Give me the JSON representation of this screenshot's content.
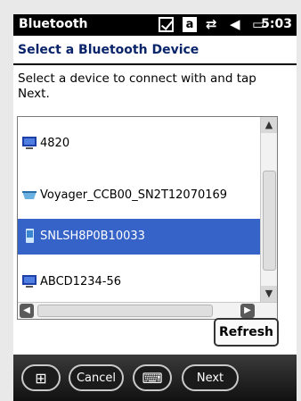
{
  "statusbar": {
    "title": "Bluetooth",
    "a_badge": "a",
    "time": "5:03",
    "icons": [
      "checkbox-icon",
      "a-badge-icon",
      "sync-icon",
      "volume-icon",
      "battery-icon"
    ]
  },
  "page": {
    "header": "Select a Bluetooth Device",
    "instruction": "Select a device to connect with and tap Next."
  },
  "devices": [
    {
      "label": "4820",
      "icon": "computer-icon",
      "selected": false
    },
    {
      "label": "Voyager_CCB00_SN2T12070169",
      "icon": "scanner-icon",
      "selected": false
    },
    {
      "label": "SNLSH8P0B10033",
      "icon": "phone-icon",
      "selected": true
    },
    {
      "label": "ABCD1234-56",
      "icon": "computer-icon",
      "selected": false
    }
  ],
  "buttons": {
    "refresh": "Refresh",
    "cancel": "Cancel",
    "next": "Next"
  },
  "colors": {
    "selection": "#3563c8",
    "header_text": "#0a246a"
  }
}
